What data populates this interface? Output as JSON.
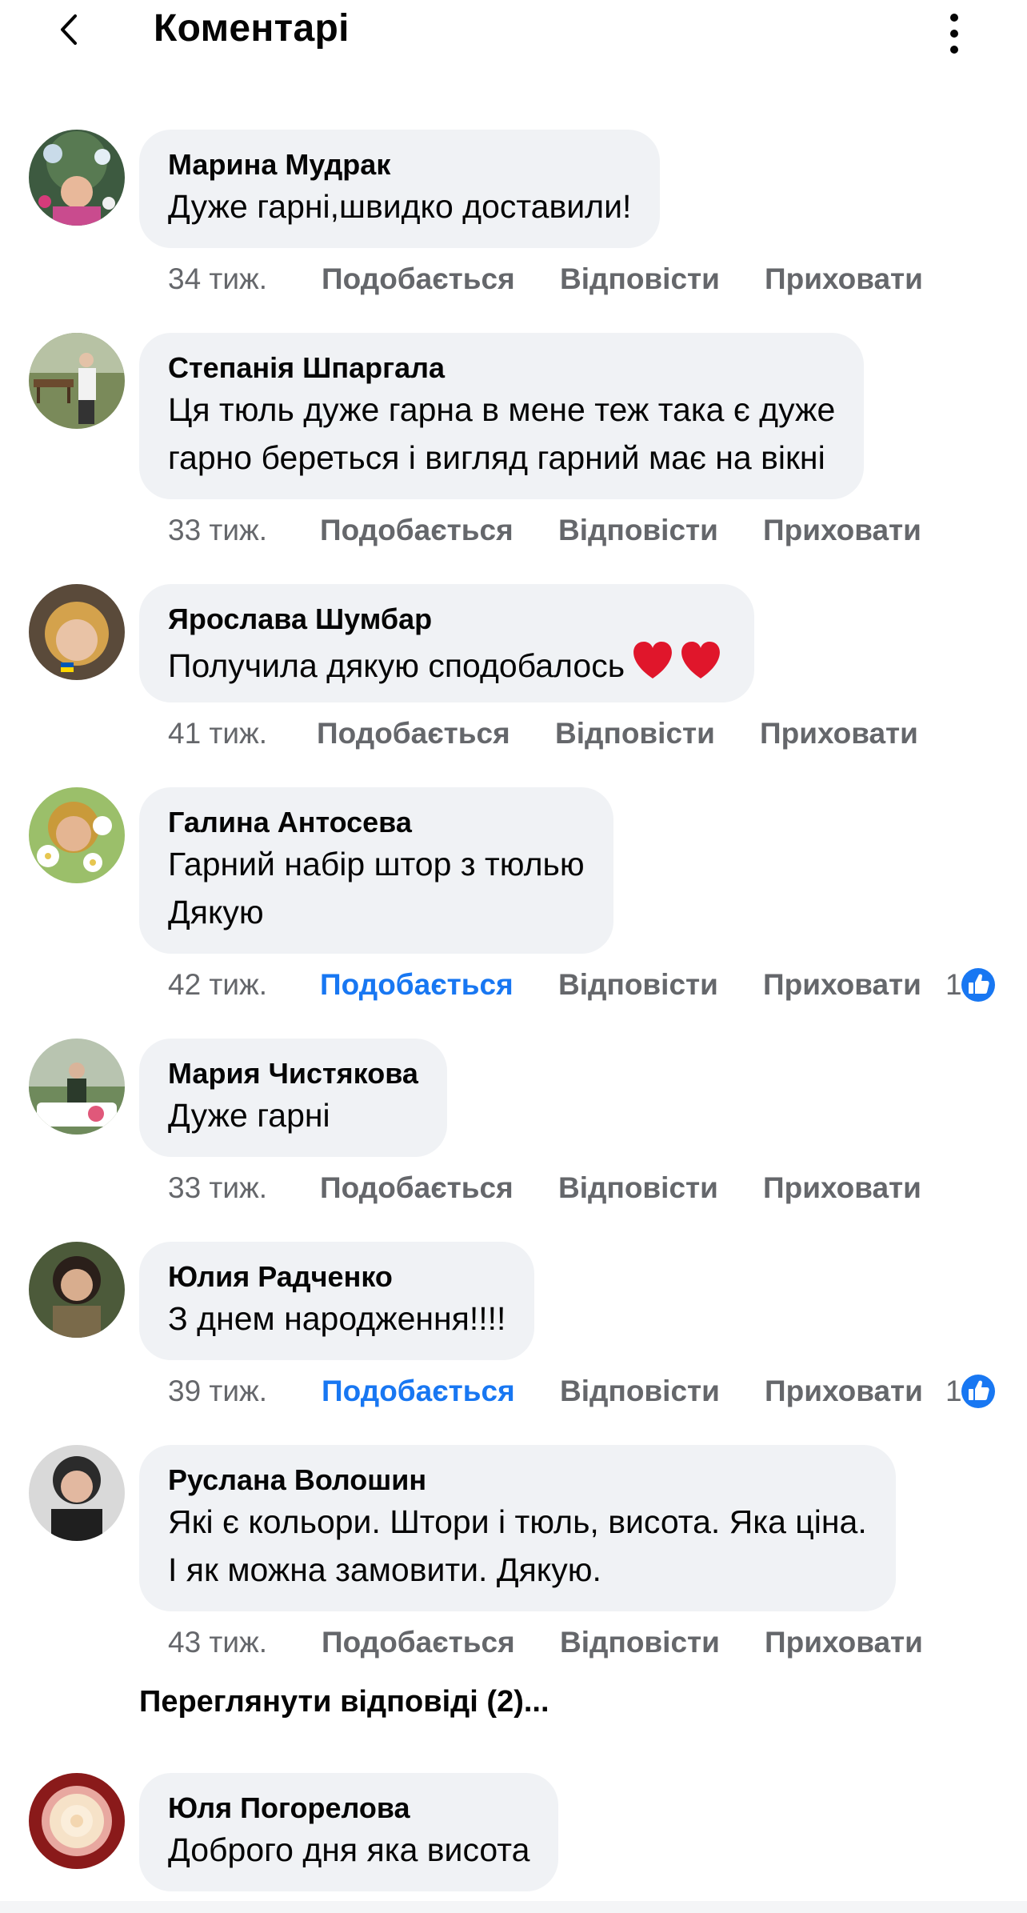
{
  "header": {
    "title": "Коментарі",
    "back_icon": "chevron-left-icon",
    "more_icon": "vertical-dots-icon"
  },
  "actions_labels": {
    "like": "Подобається",
    "reply": "Відповісти",
    "hide": "Приховати"
  },
  "colors": {
    "bubble": "#f0f2f5",
    "liked": "#1877f2",
    "secondary_text": "#65676b"
  },
  "comments": [
    {
      "author": "Марина Мудрак",
      "text": "Дуже гарні,швидко доставили!",
      "time": "34 тиж.",
      "liked": false
    },
    {
      "author": "Степанія Шпаргала",
      "text": "Ця тюль дуже гарна в мене теж така є дуже\nгарно береться і вигляд гарний має на вікні",
      "time": "33 тиж.",
      "liked": false
    },
    {
      "author": "Ярослава Шумбар",
      "text": "Получила дякую сподобалось",
      "emoji": "❤️❤️",
      "time": "41 тиж.",
      "liked": false
    },
    {
      "author": "Галина Антосева",
      "text": "Гарний набір штор з тюлью\nДякую",
      "time": "42 тиж.",
      "liked": true,
      "reaction_count": "1",
      "reaction_icon": "like-thumb-icon"
    },
    {
      "author": "Мария Чистякова",
      "text": "Дуже гарні",
      "time": "33 тиж.",
      "liked": false
    },
    {
      "author": "Юлия Радченко",
      "text": "З днем народження!!!!",
      "time": "39 тиж.",
      "liked": true,
      "reaction_count": "1",
      "reaction_icon": "like-thumb-icon"
    },
    {
      "author": "Руслана Волошин",
      "text": "Які є кольори. Штори і тюль, висота. Яка ціна.\nІ як можна замовити. Дякую.",
      "time": "43 тиж.",
      "liked": false
    },
    {
      "author": "Юля Погорелова",
      "text": "Доброго дня яка висота"
    }
  ],
  "view_replies": "Переглянути відповіді (2)..."
}
